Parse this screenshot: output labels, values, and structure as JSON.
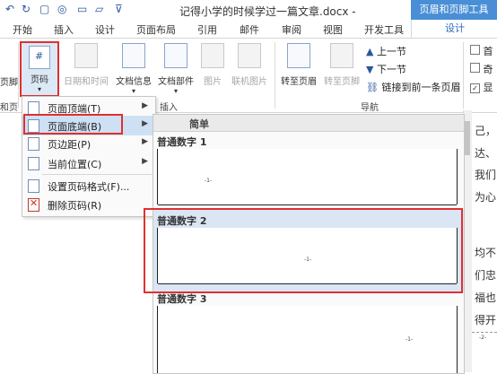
{
  "title_bar": {
    "title": "记得小学的时候学过一篇文章.docx - Word",
    "context_tab_header": "页眉和页脚工具"
  },
  "tabs": [
    "开始",
    "插入",
    "设计",
    "页面布局",
    "引用",
    "邮件",
    "审阅",
    "视图",
    "开发工具"
  ],
  "active_context_tab": "设计",
  "ribbon": {
    "left_cut_label": "页脚",
    "left_cut_group": "和页",
    "page_number": "页码",
    "date_time": "日期和时间",
    "doc_info": "文档信息",
    "doc_parts": "文档部件",
    "picture": "图片",
    "online_picture": "联机图片",
    "insert_group": "插入",
    "goto_header": "转至页眉",
    "goto_footer": "转至页脚",
    "prev_section": "上一节",
    "next_section": "下一节",
    "link_previous": "链接到前一条页眉",
    "nav_group": "导航",
    "opt_first": "首",
    "opt_odd": "奇",
    "opt_show": "显"
  },
  "menu": {
    "items": [
      {
        "label": "页面顶端(T)",
        "arrow": "▶"
      },
      {
        "label": "页面底端(B)",
        "arrow": "▶"
      },
      {
        "label": "页边距(P)",
        "arrow": "▶"
      },
      {
        "label": "当前位置(C)",
        "arrow": "▶"
      },
      {
        "label": "设置页码格式(F)...",
        "arrow": ""
      },
      {
        "label": "删除页码(R)",
        "arrow": ""
      }
    ]
  },
  "gallery": {
    "header": "简单",
    "items": [
      {
        "label": "普通数字 1",
        "sample": "-1-"
      },
      {
        "label": "普通数字 2",
        "sample": "-1-"
      },
      {
        "label": "普通数字 3",
        "sample": "-1-"
      }
    ]
  },
  "document": {
    "lines": [
      "己，",
      "达、",
      "我们",
      "为心",
      "均不",
      "们忠",
      "福也",
      "得开"
    ],
    "footer_sample": "-2-"
  },
  "colors": {
    "accent": "#2b579a",
    "context": "#4a8fd6",
    "highlight": "#e03030"
  }
}
